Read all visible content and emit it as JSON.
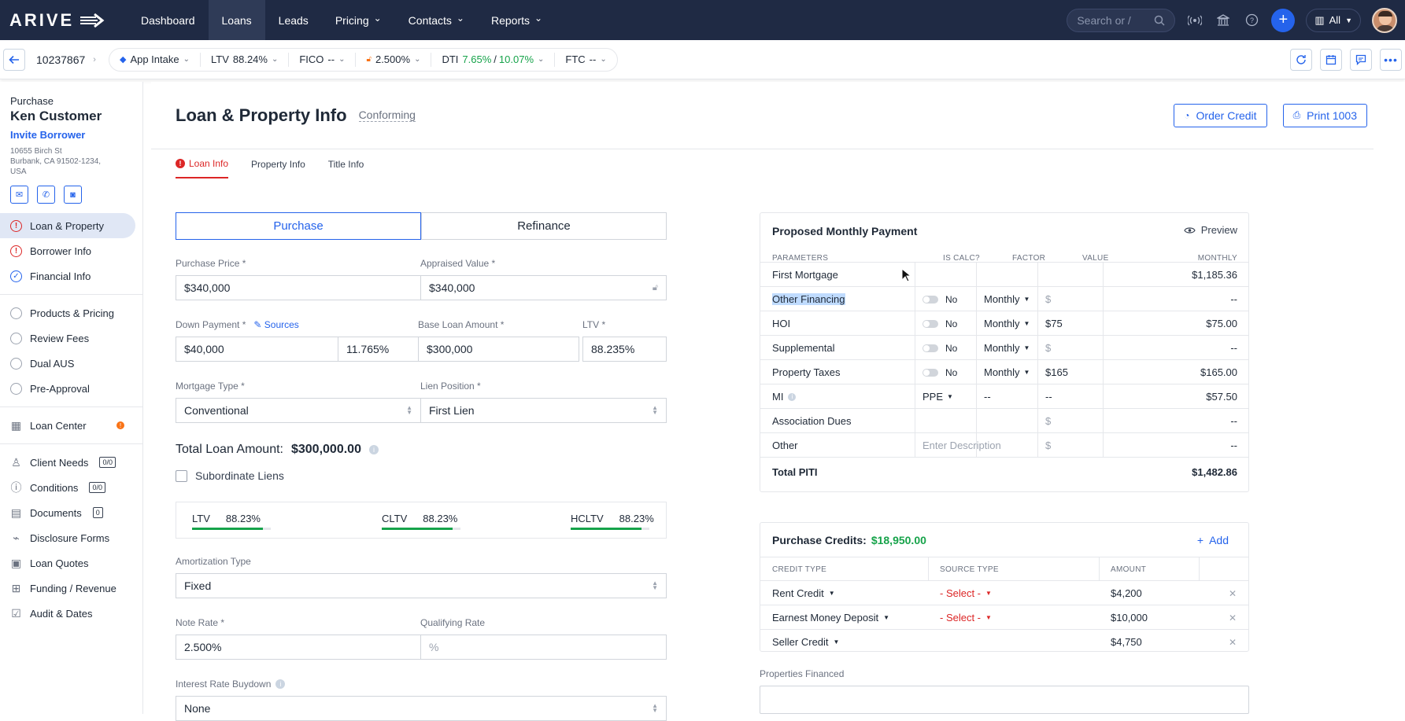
{
  "app": {
    "brand": "ARIVE"
  },
  "nav": {
    "items": [
      {
        "label": "Dashboard",
        "dropdown": false
      },
      {
        "label": "Loans",
        "dropdown": false
      },
      {
        "label": "Leads",
        "dropdown": false
      },
      {
        "label": "Pricing",
        "dropdown": true
      },
      {
        "label": "Contacts",
        "dropdown": true
      },
      {
        "label": "Reports",
        "dropdown": true
      }
    ],
    "active": "Loans",
    "search_placeholder": "Search or /",
    "all_label": "All"
  },
  "subbar": {
    "loan_id": "10237867",
    "stage": "App Intake",
    "ltv_label": "LTV",
    "ltv_value": "88.24%",
    "fico_label": "FICO",
    "fico_value": "--",
    "rate_value": "2.500%",
    "dti_label": "DTI",
    "dti_front": "7.65%",
    "dti_sep": "/",
    "dti_back": "10.07%",
    "ftc_label": "FTC",
    "ftc_value": "--"
  },
  "borrower": {
    "type": "Purchase",
    "name": "Ken Customer",
    "invite": "Invite Borrower",
    "addr1": "10655 Birch St",
    "addr2": "Burbank, CA 91502-1234,",
    "addr3": "USA"
  },
  "sidebar": {
    "group1": [
      {
        "label": "Loan & Property",
        "status": "error",
        "active": true
      },
      {
        "label": "Borrower Info",
        "status": "error"
      },
      {
        "label": "Financial Info",
        "status": "ok"
      }
    ],
    "group2": [
      {
        "label": "Products & Pricing"
      },
      {
        "label": "Review Fees"
      },
      {
        "label": "Dual AUS"
      },
      {
        "label": "Pre-Approval"
      }
    ],
    "loan_center": "Loan Center",
    "group3": [
      {
        "label": "Client Needs",
        "count": "0/0"
      },
      {
        "label": "Conditions",
        "count": "0/0"
      },
      {
        "label": "Documents",
        "count": "0"
      },
      {
        "label": "Disclosure Forms"
      },
      {
        "label": "Loan Quotes"
      },
      {
        "label": "Funding / Revenue"
      },
      {
        "label": "Audit & Dates"
      }
    ]
  },
  "page": {
    "title": "Loan & Property Info",
    "subtitle": "Conforming",
    "order_credit": "Order Credit",
    "print": "Print 1003"
  },
  "tabs": [
    "Loan Info",
    "Property Info",
    "Title Info"
  ],
  "form": {
    "purchase": "Purchase",
    "refinance": "Refinance",
    "purchase_price_label": "Purchase Price *",
    "purchase_price": "$340,000",
    "appraised_label": "Appraised Value *",
    "appraised": "$340,000",
    "down_label": "Down Payment *",
    "sources": "Sources",
    "down_amount": "$40,000",
    "down_pct": "11.765%",
    "base_label": "Base Loan Amount *",
    "base": "$300,000",
    "ltv_label": "LTV *",
    "ltv": "88.235%",
    "mort_label": "Mortgage Type *",
    "mort": "Conventional",
    "lien_label": "Lien Position *",
    "lien": "First Lien",
    "total_label": "Total Loan Amount:",
    "total": "$300,000.00",
    "sub_liens": "Subordinate Liens",
    "ltv_m": "LTV",
    "ltv_v": "88.23%",
    "cltv_m": "CLTV",
    "cltv_v": "88.23%",
    "hcltv_m": "HCLTV",
    "hcltv_v": "88.23%",
    "ltv_fill": 0.9,
    "amort_label": "Amortization Type",
    "amort": "Fixed",
    "note_label": "Note Rate *",
    "note": "2.500%",
    "qual_label": "Qualifying Rate",
    "qual_placeholder": "%",
    "buydown_label": "Interest Rate Buydown",
    "buydown": "None"
  },
  "pmp": {
    "title": "Proposed Monthly Payment",
    "preview": "Preview",
    "headers": [
      "PARAMETERS",
      "IS CALC?",
      "FACTOR",
      "VALUE",
      "MONTHLY"
    ],
    "rows": [
      {
        "param": "First Mortgage",
        "calc": "",
        "factor": "",
        "value": "",
        "monthly": "$1,185.36"
      },
      {
        "param": "Other Financing",
        "calc": "No",
        "factor": "Monthly",
        "value": "$",
        "monthly": "--"
      },
      {
        "param": "HOI",
        "calc": "No",
        "factor": "Monthly",
        "value": "$75",
        "monthly": "$75.00"
      },
      {
        "param": "Supplemental",
        "calc": "No",
        "factor": "Monthly",
        "value": "$",
        "monthly": "--"
      },
      {
        "param": "Property Taxes",
        "calc": "No",
        "factor": "Monthly",
        "value": "$165",
        "monthly": "$165.00"
      },
      {
        "param": "MI",
        "calc": "PPE",
        "factor": "--",
        "value": "--",
        "monthly": "$57.50"
      },
      {
        "param": "Association Dues",
        "calc": "",
        "factor": "",
        "value": "$",
        "monthly": "--"
      },
      {
        "param": "Other",
        "calc": "Enter Description",
        "factor": "",
        "value": "$",
        "monthly": "--"
      }
    ],
    "total_label": "Total PITI",
    "total": "$1,482.86"
  },
  "credits": {
    "title": "Purchase Credits:",
    "total": "$18,950.00",
    "add": "Add",
    "headers": [
      "CREDIT TYPE",
      "SOURCE TYPE",
      "AMOUNT"
    ],
    "rows": [
      {
        "type": "Rent Credit",
        "source": "- Select -",
        "amount": "$4,200"
      },
      {
        "type": "Earnest Money Deposit",
        "source": "- Select -",
        "amount": "$10,000"
      },
      {
        "type": "Seller Credit",
        "source": "",
        "amount": "$4,750"
      }
    ]
  },
  "properties_financed": "Properties Financed",
  "colors": {
    "nav": "#1f2a44",
    "accent": "#2563eb",
    "error": "#dc2626",
    "success": "#16a34a"
  }
}
